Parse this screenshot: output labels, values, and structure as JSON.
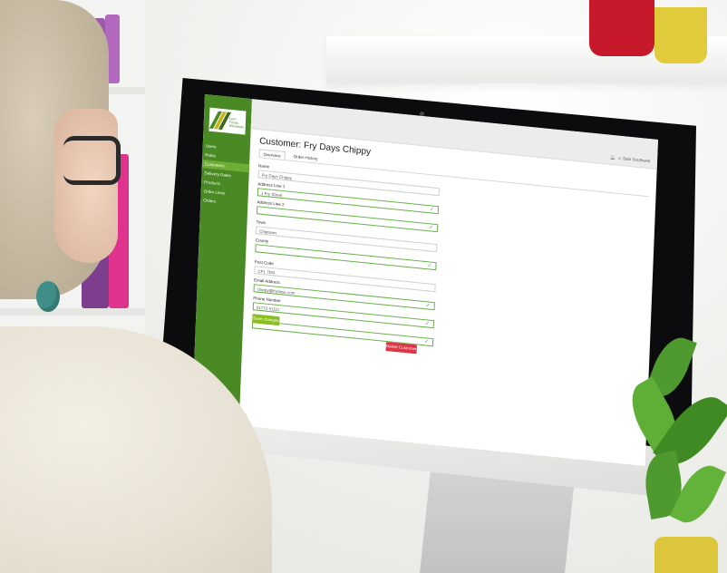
{
  "sidebar": {
    "logo_text": "Lyon Foods Wholesale",
    "items": [
      {
        "label": "Users"
      },
      {
        "label": "Roles"
      },
      {
        "label": "Customers"
      },
      {
        "label": "Delivery Dates"
      },
      {
        "label": "Products"
      },
      {
        "label": "Order Lines"
      },
      {
        "label": "Orders"
      }
    ],
    "active_index": 2
  },
  "topbar": {
    "user_label": "Sam Southwell"
  },
  "page": {
    "title": "Customer: Fry Days Chippy",
    "tabs": [
      {
        "label": "Overview"
      },
      {
        "label": "Order History"
      }
    ],
    "active_tab": 0
  },
  "form": {
    "fields": [
      {
        "label": "Name",
        "value": "Fry Days Chippy",
        "valid": false
      },
      {
        "label": "Address Line 1",
        "value": "1 Fry Street",
        "valid": true
      },
      {
        "label": "Address Line 2",
        "value": "",
        "valid": true
      },
      {
        "label": "Town",
        "value": "Chiptown",
        "valid": false
      },
      {
        "label": "County",
        "value": "",
        "valid": true
      },
      {
        "label": "Post Code",
        "value": "CF1 7DN",
        "valid": false
      },
      {
        "label": "Email Address",
        "value": "chippy@frydays.com",
        "valid": true
      },
      {
        "label": "Phone Number",
        "value": "01772 01111",
        "valid": true
      }
    ],
    "save_label": "Save changes",
    "delete_label": "Delete Customer"
  },
  "colors": {
    "sidebar": "#4a8a24",
    "active_nav": "#6fae35",
    "save": "#8bbf1f",
    "delete": "#dc3545",
    "valid": "#4caf50"
  }
}
